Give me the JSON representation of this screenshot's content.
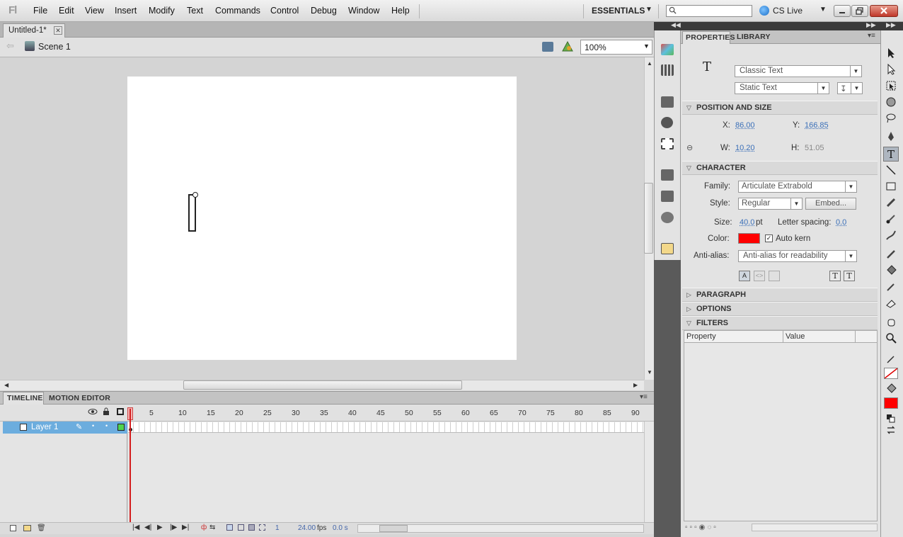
{
  "app": {
    "logo": "Fl",
    "menu": [
      "File",
      "Edit",
      "View",
      "Insert",
      "Modify",
      "Text",
      "Commands",
      "Control",
      "Debug",
      "Window",
      "Help"
    ],
    "workspace": "ESSENTIALS",
    "search_placeholder": "",
    "cs_live": "CS Live"
  },
  "document": {
    "tab_title": "Untitled-1*",
    "scene": "Scene 1",
    "zoom": "100%"
  },
  "timeline": {
    "tabs": [
      "TIMELINE",
      "MOTION EDITOR"
    ],
    "frame_ticks": [
      "1",
      "5",
      "10",
      "15",
      "20",
      "25",
      "30",
      "35",
      "40",
      "45",
      "50",
      "55",
      "60",
      "65",
      "70",
      "75",
      "80",
      "85",
      "90"
    ],
    "layer_name": "Layer 1",
    "current_frame": "1",
    "fps": "24.00",
    "fps_unit": "fps",
    "elapsed": "0.0 s"
  },
  "properties": {
    "tabs": [
      "PROPERTIES",
      "LIBRARY"
    ],
    "tool_glyph": "T",
    "text_engine": "Classic Text",
    "text_type": "Static Text",
    "position_size": {
      "title": "POSITION AND SIZE",
      "x_label": "X:",
      "x": "86.00",
      "y_label": "Y:",
      "y": "166.85",
      "w_label": "W:",
      "w": "10.20",
      "h_label": "H:",
      "h": "51.05"
    },
    "character": {
      "title": "CHARACTER",
      "family_label": "Family:",
      "family": "Articulate Extrabold",
      "style_label": "Style:",
      "style": "Regular",
      "embed": "Embed...",
      "size_label": "Size:",
      "size": "40.0",
      "size_unit": "pt",
      "letter_spacing_label": "Letter spacing:",
      "letter_spacing": "0.0",
      "color_label": "Color:",
      "color": "#ff0000",
      "auto_kern": "Auto kern",
      "anti_alias_label": "Anti-alias:",
      "anti_alias": "Anti-alias for readability"
    },
    "paragraph_title": "PARAGRAPH",
    "options_title": "OPTIONS",
    "filters": {
      "title": "FILTERS",
      "col_property": "Property",
      "col_value": "Value"
    }
  },
  "colors": {
    "fill": "#ff0000",
    "layer_highlight": "#6cadde",
    "playhead": "#d31d1d"
  }
}
